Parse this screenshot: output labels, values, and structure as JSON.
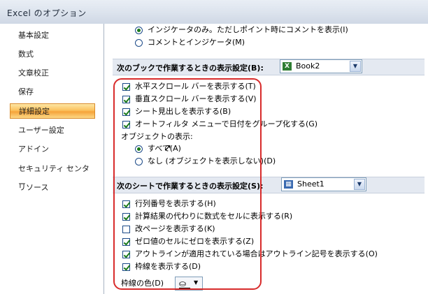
{
  "window": {
    "title": "Excel のオプション"
  },
  "sidebar": {
    "items": [
      {
        "label": "基本設定"
      },
      {
        "label": "数式"
      },
      {
        "label": "文章校正"
      },
      {
        "label": "保存"
      },
      {
        "label": "詳細設定"
      },
      {
        "label": "ユーザー設定"
      },
      {
        "label": "アドイン"
      },
      {
        "label": "セキュリティ センター"
      },
      {
        "label": "リソース"
      }
    ],
    "selected": "詳細設定"
  },
  "top_options": [
    {
      "label": "インジケータのみ。ただしポイント時にコメントを表示(I)",
      "checked": true
    },
    {
      "label": "コメントとインジケータ(M)",
      "checked": false
    }
  ],
  "book_section": {
    "title": "次のブックで作業するときの表示設定(B):",
    "combo_value": "Book2",
    "options": [
      {
        "label": "水平スクロール バーを表示する(T)",
        "checked": true
      },
      {
        "label": "垂直スクロール バーを表示する(V)",
        "checked": true
      },
      {
        "label": "シート見出しを表示する(B)",
        "checked": true
      },
      {
        "label": "オートフィルタ メニューで日付をグループ化する(G)",
        "checked": true
      }
    ],
    "objects_label": "オブジェクトの表示:",
    "object_options": [
      {
        "label": "すべて(A)",
        "checked": true
      },
      {
        "label": "なし (オブジェクトを表示しない)(D)",
        "checked": false
      }
    ]
  },
  "sheet_section": {
    "title": "次のシートで作業するときの表示設定(S):",
    "combo_value": "Sheet1",
    "options": [
      {
        "label": "行列番号を表示する(H)",
        "checked": true
      },
      {
        "label": "計算結果の代わりに数式をセルに表示する(R)",
        "checked": true
      },
      {
        "label": "改ページを表示する(K)",
        "checked": false
      },
      {
        "label": "ゼロ値のセルにゼロを表示する(Z)",
        "checked": true
      },
      {
        "label": "アウトラインが適用されている場合はアウトライン記号を表示する(O)",
        "checked": true
      },
      {
        "label": "枠線を表示する(D)",
        "checked": true
      }
    ],
    "gridline_color_label": "枠線の色(D)"
  },
  "colors": {
    "selected_nav": "#f6a33a",
    "highlight_border": "#d82b2b",
    "check": "#1a7a1a"
  },
  "icons": {
    "excel_book": "excel-book-icon",
    "fill_color": "paint-bucket-icon"
  }
}
